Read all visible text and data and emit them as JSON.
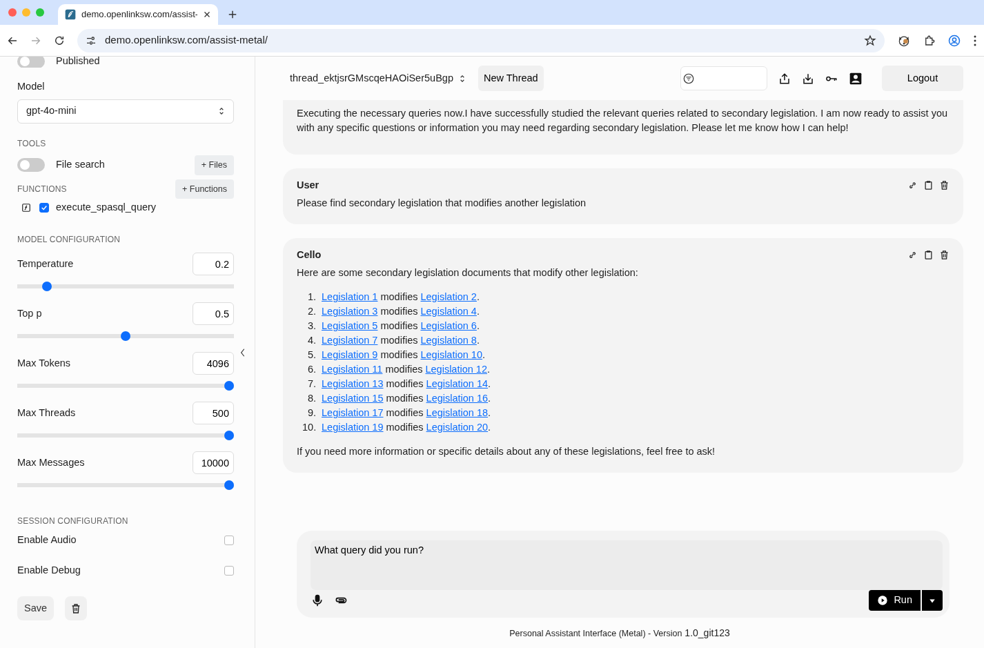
{
  "browser": {
    "tab_title": "demo.openlinksw.com/assist-",
    "url": "demo.openlinksw.com/assist-metal/"
  },
  "sidebar": {
    "published": {
      "label": "Published",
      "on": false
    },
    "model": {
      "label": "Model",
      "value": "gpt-4o-mini"
    },
    "tools": {
      "heading": "TOOLS",
      "file_search": {
        "label": "File search",
        "on": false
      },
      "files_button": "+ Files"
    },
    "functions": {
      "heading": "FUNCTIONS",
      "button": "+ Functions",
      "items": [
        {
          "name": "execute_spasql_query",
          "checked": true
        }
      ]
    },
    "model_config": {
      "heading": "MODEL CONFIGURATION",
      "params": [
        {
          "label": "Temperature",
          "value": "0.2",
          "level": 0.12
        },
        {
          "label": "Top p",
          "value": "0.5",
          "level": 0.5
        },
        {
          "label": "Max Tokens",
          "value": "4096",
          "level": 1
        },
        {
          "label": "Max Threads",
          "value": "500",
          "level": 1
        },
        {
          "label": "Max Messages",
          "value": "10000",
          "level": 1
        }
      ]
    },
    "session": {
      "heading": "SESSION CONFIGURATION",
      "options": [
        {
          "label": "Enable Audio",
          "checked": false
        },
        {
          "label": "Enable Debug",
          "checked": false
        }
      ]
    },
    "save_button": "Save"
  },
  "header": {
    "thread": "thread_ektjsrGMscqeHAOiSer5uBgp",
    "new_thread": "New Thread",
    "logout": "Logout"
  },
  "messages": [
    {
      "paragraphs": [
        "Executing the necessary queries now.I have successfully studied the relevant queries related to secondary legislation. I am now ready to assist you with any specific questions or information you may need regarding secondary legislation. Please let me know how I can help!"
      ]
    },
    {
      "author": "User",
      "paragraphs": [
        "Please find secondary legislation that modifies another legislation"
      ]
    },
    {
      "author": "Cello",
      "paragraphs": [
        "Here are some secondary legislation documents that modify other legislation:"
      ],
      "items": [
        {
          "number": "1.",
          "source": "Legislation 1",
          "verb": "modifies",
          "target": "Legislation 2",
          "end": "."
        },
        {
          "number": "2.",
          "source": "Legislation 3",
          "verb": "modifies",
          "target": "Legislation 4",
          "end": "."
        },
        {
          "number": "3.",
          "source": "Legislation 5",
          "verb": "modifies",
          "target": "Legislation 6",
          "end": "."
        },
        {
          "number": "4.",
          "source": "Legislation 7",
          "verb": "modifies",
          "target": "Legislation 8",
          "end": "."
        },
        {
          "number": "5.",
          "source": "Legislation 9",
          "verb": "modifies",
          "target": "Legislation 10",
          "end": "."
        },
        {
          "number": "6.",
          "source": "Legislation 11",
          "verb": "modifies",
          "target": "Legislation 12",
          "end": "."
        },
        {
          "number": "7.",
          "source": "Legislation 13",
          "verb": "modifies",
          "target": "Legislation 14",
          "end": "."
        },
        {
          "number": "8.",
          "source": "Legislation 15",
          "verb": "modifies",
          "target": "Legislation 16",
          "end": "."
        },
        {
          "number": "9.",
          "source": "Legislation 17",
          "verb": "modifies",
          "target": "Legislation 18",
          "end": "."
        },
        {
          "number": "10.",
          "source": "Legislation 19",
          "verb": "modifies",
          "target": "Legislation 20",
          "end": "."
        }
      ],
      "outro": "If you need more information or specific details about any of these legislations, feel free to ask!"
    }
  ],
  "composer": {
    "value": "What query did you run?",
    "run_button": "Run"
  },
  "footer": {
    "text": "Personal Assistant Interface (Metal) - Version",
    "version": "1.0_git123"
  }
}
